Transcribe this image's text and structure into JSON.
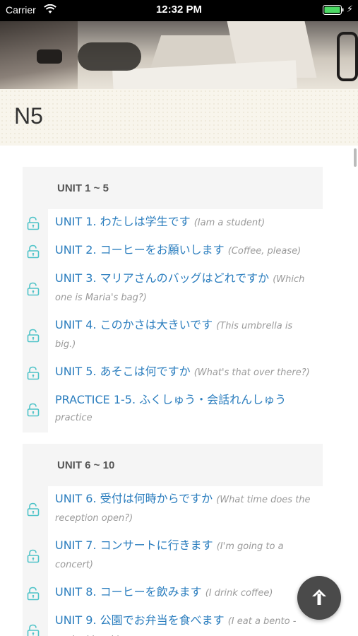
{
  "status_bar": {
    "carrier": "Carrier",
    "time": "12:32 PM"
  },
  "page": {
    "title": "N5"
  },
  "sections": [
    {
      "header": "UNIT 1 ~ 5",
      "lessons": [
        {
          "title": "UNIT 1. わたしは学生です",
          "subtitle": "(Iam a student)"
        },
        {
          "title": "UNIT 2. コーヒーをお願いします",
          "subtitle": "(Coffee, please)"
        },
        {
          "title": "UNIT 3. マリアさんのバッグはどれですか",
          "subtitle": "(Which one is Maria's bag?)"
        },
        {
          "title": "UNIT 4. このかさは大きいです",
          "subtitle": "(This umbrella is big.)"
        },
        {
          "title": "UNIT 5. あそこは何ですか",
          "subtitle": "(What's that over there?)"
        },
        {
          "title": "PRACTICE 1-5. ふくしゅう・会話れんしゅう",
          "subtitle": "practice"
        }
      ]
    },
    {
      "header": "UNIT 6 ~ 10",
      "lessons": [
        {
          "title": "UNIT 6. 受付は何時からですか",
          "subtitle": "(What time does the reception open?)"
        },
        {
          "title": "UNIT 7. コンサートに行きます",
          "subtitle": "(I'm going to a concert)"
        },
        {
          "title": "UNIT 8. コーヒーを飲みます",
          "subtitle": "(I drink coffee)"
        },
        {
          "title": "UNIT 9. 公園でお弁当を食べます",
          "subtitle": "(I eat a bento - packed lunch)"
        }
      ]
    }
  ],
  "colors": {
    "link": "#2a7dbe",
    "lock": "#4fc3c8",
    "fab": "#4a4a4a"
  },
  "icons": {
    "lock": "unlock-icon",
    "fab": "arrow-up-icon"
  }
}
